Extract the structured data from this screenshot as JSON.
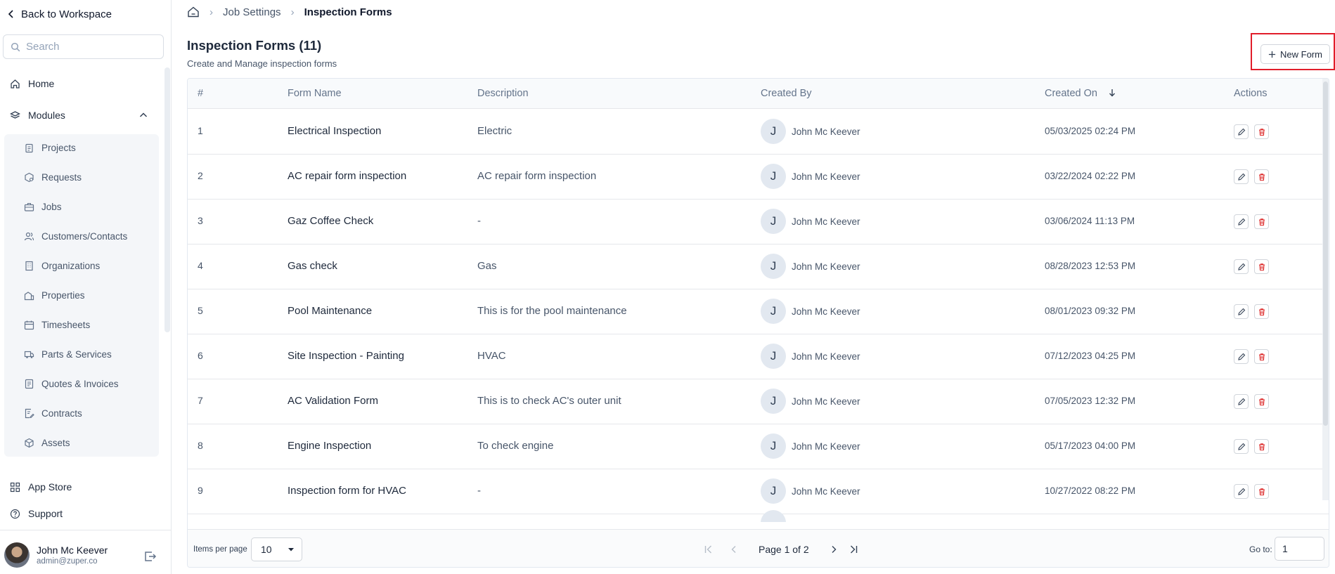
{
  "sidebar": {
    "back_label": "Back to Workspace",
    "search_placeholder": "Search",
    "home_label": "Home",
    "modules_label": "Modules",
    "module_items": [
      {
        "label": "Projects",
        "icon": "clipboard-icon"
      },
      {
        "label": "Requests",
        "icon": "box-cog-icon"
      },
      {
        "label": "Jobs",
        "icon": "briefcase-icon"
      },
      {
        "label": "Customers/Contacts",
        "icon": "users-icon"
      },
      {
        "label": "Organizations",
        "icon": "building-icon"
      },
      {
        "label": "Properties",
        "icon": "buildings-icon"
      },
      {
        "label": "Timesheets",
        "icon": "calendar-icon"
      },
      {
        "label": "Parts & Services",
        "icon": "truck-icon"
      },
      {
        "label": "Quotes & Invoices",
        "icon": "invoice-icon"
      },
      {
        "label": "Contracts",
        "icon": "contract-icon"
      },
      {
        "label": "Assets",
        "icon": "cube-icon"
      }
    ],
    "app_store_label": "App Store",
    "support_label": "Support",
    "user": {
      "name": "John Mc Keever",
      "email": "admin@zuper.co"
    }
  },
  "breadcrumb": {
    "first": "Job Settings",
    "current": "Inspection Forms"
  },
  "page": {
    "title": "Inspection Forms (11)",
    "subtitle": "Create and Manage inspection forms",
    "new_button": "New Form"
  },
  "table": {
    "columns": [
      "#",
      "Form Name",
      "Description",
      "Created By",
      "Created On",
      "Actions"
    ],
    "sort_column": "Created On",
    "rows": [
      {
        "idx": "1",
        "name": "Electrical Inspection",
        "description": "Electric",
        "initial": "J",
        "created_by": "John Mc Keever",
        "created_on": "05/03/2025 02:24 PM"
      },
      {
        "idx": "2",
        "name": "AC repair form inspection",
        "description": "AC repair form inspection",
        "initial": "J",
        "created_by": "John Mc Keever",
        "created_on": "03/22/2024 02:22 PM"
      },
      {
        "idx": "3",
        "name": "Gaz Coffee Check",
        "description": "-",
        "initial": "J",
        "created_by": "John Mc Keever",
        "created_on": "03/06/2024 11:13 PM"
      },
      {
        "idx": "4",
        "name": "Gas check",
        "description": "Gas",
        "initial": "J",
        "created_by": "John Mc Keever",
        "created_on": "08/28/2023 12:53 PM"
      },
      {
        "idx": "5",
        "name": "Pool Maintenance",
        "description": "This is for the pool maintenance",
        "initial": "J",
        "created_by": "John Mc Keever",
        "created_on": "08/01/2023 09:32 PM"
      },
      {
        "idx": "6",
        "name": "Site Inspection - Painting",
        "description": "HVAC",
        "initial": "J",
        "created_by": "John Mc Keever",
        "created_on": "07/12/2023 04:25 PM"
      },
      {
        "idx": "7",
        "name": "AC Validation Form",
        "description": "This is to check AC's outer unit",
        "initial": "J",
        "created_by": "John Mc Keever",
        "created_on": "07/05/2023 12:32 PM"
      },
      {
        "idx": "8",
        "name": "Engine Inspection",
        "description": "To check engine",
        "initial": "J",
        "created_by": "John Mc Keever",
        "created_on": "05/17/2023 04:00 PM"
      },
      {
        "idx": "9",
        "name": "Inspection form for HVAC",
        "description": "-",
        "initial": "J",
        "created_by": "John Mc Keever",
        "created_on": "10/27/2022 08:22 PM"
      }
    ]
  },
  "pagination": {
    "items_per_page_label": "Items per page",
    "items_per_page": "10",
    "page_label": "Page 1 of 2",
    "goto_label": "Go to:",
    "goto_value": "1"
  },
  "colors": {
    "accent_red": "#e11d2a",
    "delete_red": "#dc2626"
  }
}
